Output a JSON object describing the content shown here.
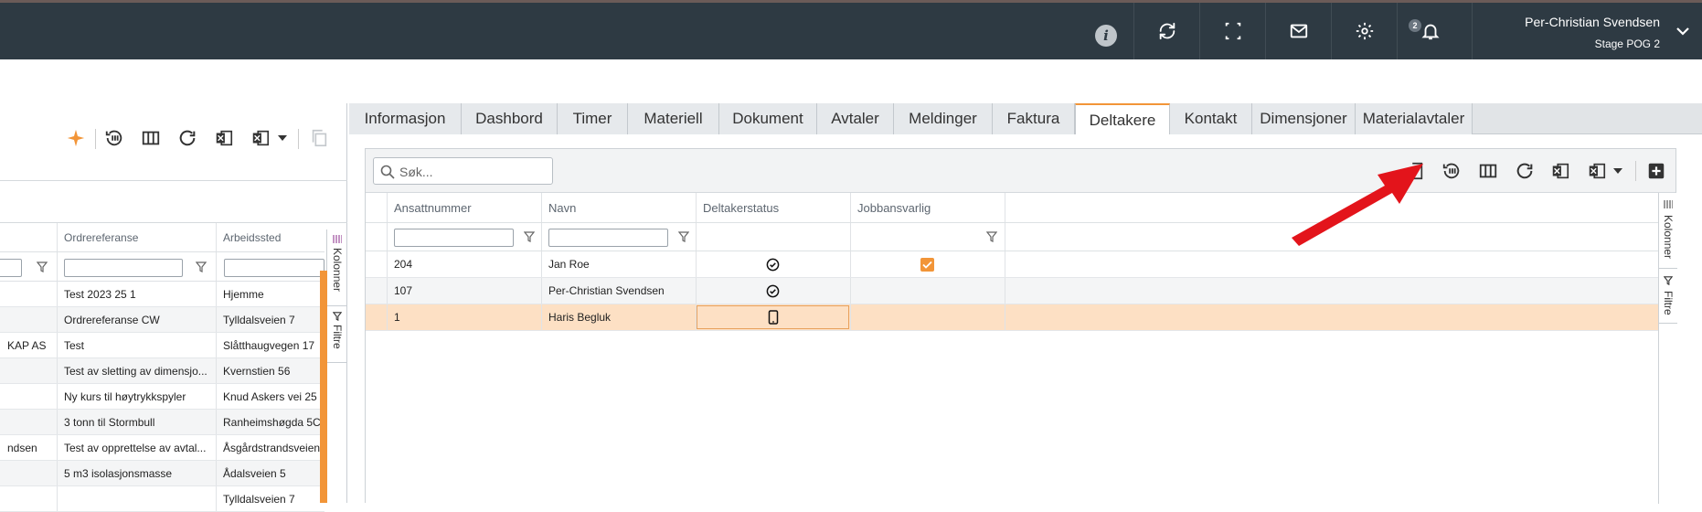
{
  "header": {
    "user_name": "Per-Christian Svendsen",
    "user_context": "Stage POG 2",
    "notification_count": "2",
    "icons": [
      "info-icon",
      "sync-icon",
      "fullscreen-icon",
      "mail-icon",
      "settings-icon",
      "bell-icon",
      "chevron-down-icon"
    ]
  },
  "left_grid": {
    "columns": [
      "Ordrereferanse",
      "Arbeidssted"
    ],
    "rows": [
      {
        "c0": "",
        "c1": "Test 2023 25 1",
        "c2": "Hjemme"
      },
      {
        "c0": "",
        "c1": "Ordrereferanse CW",
        "c2": "Tylldalsveien 7"
      },
      {
        "c0": "KAP AS",
        "c1": "Test",
        "c2": "Slåtthaugvegen 17"
      },
      {
        "c0": "",
        "c1": "Test av sletting av dimensjo...",
        "c2": "Kvernstien 56"
      },
      {
        "c0": "",
        "c1": "Ny kurs til høytrykkspyler",
        "c2": "Knud Askers vei 25"
      },
      {
        "c0": "",
        "c1": "3 tonn til Stormbull",
        "c2": "Ranheimshøgda 5C"
      },
      {
        "c0": "ndsen",
        "c1": "Test av opprettelse av avtal...",
        "c2": "Åsgårdstrandsveien"
      },
      {
        "c0": "",
        "c1": "5 m3 isolasjonsmasse",
        "c2": "Ådalsveien 5"
      },
      {
        "c0": "",
        "c1": "",
        "c2": "Tylldalsveien 7"
      }
    ],
    "side_tabs": [
      "Kolonner",
      "Filtre"
    ]
  },
  "tabs": [
    "Informasjon",
    "Dashbord",
    "Timer",
    "Materiell",
    "Dokument",
    "Avtaler",
    "Meldinger",
    "Faktura",
    "Deltakere",
    "Kontakt",
    "Dimensjoner",
    "Materialavtaler"
  ],
  "active_tab": "Deltakere",
  "participants": {
    "search_placeholder": "Søk...",
    "columns": [
      "Ansattnummer",
      "Navn",
      "Deltakerstatus",
      "Jobbansvarlig"
    ],
    "rows": [
      {
        "number": "204",
        "name": "Jan Roe",
        "status": "check-circle-icon",
        "responsible": true
      },
      {
        "number": "107",
        "name": "Per-Christian Svendsen",
        "status": "check-circle-icon",
        "responsible": false
      },
      {
        "number": "1",
        "name": "Haris Begluk",
        "status": "mobile-phone-icon",
        "responsible": false
      }
    ],
    "side_tabs": [
      "Kolonner",
      "Filtre"
    ]
  },
  "colors": {
    "topbar": "#2e3a43",
    "accent": "#f29538",
    "selected_row": "#fde0c4",
    "arrow": "#e3141b"
  }
}
